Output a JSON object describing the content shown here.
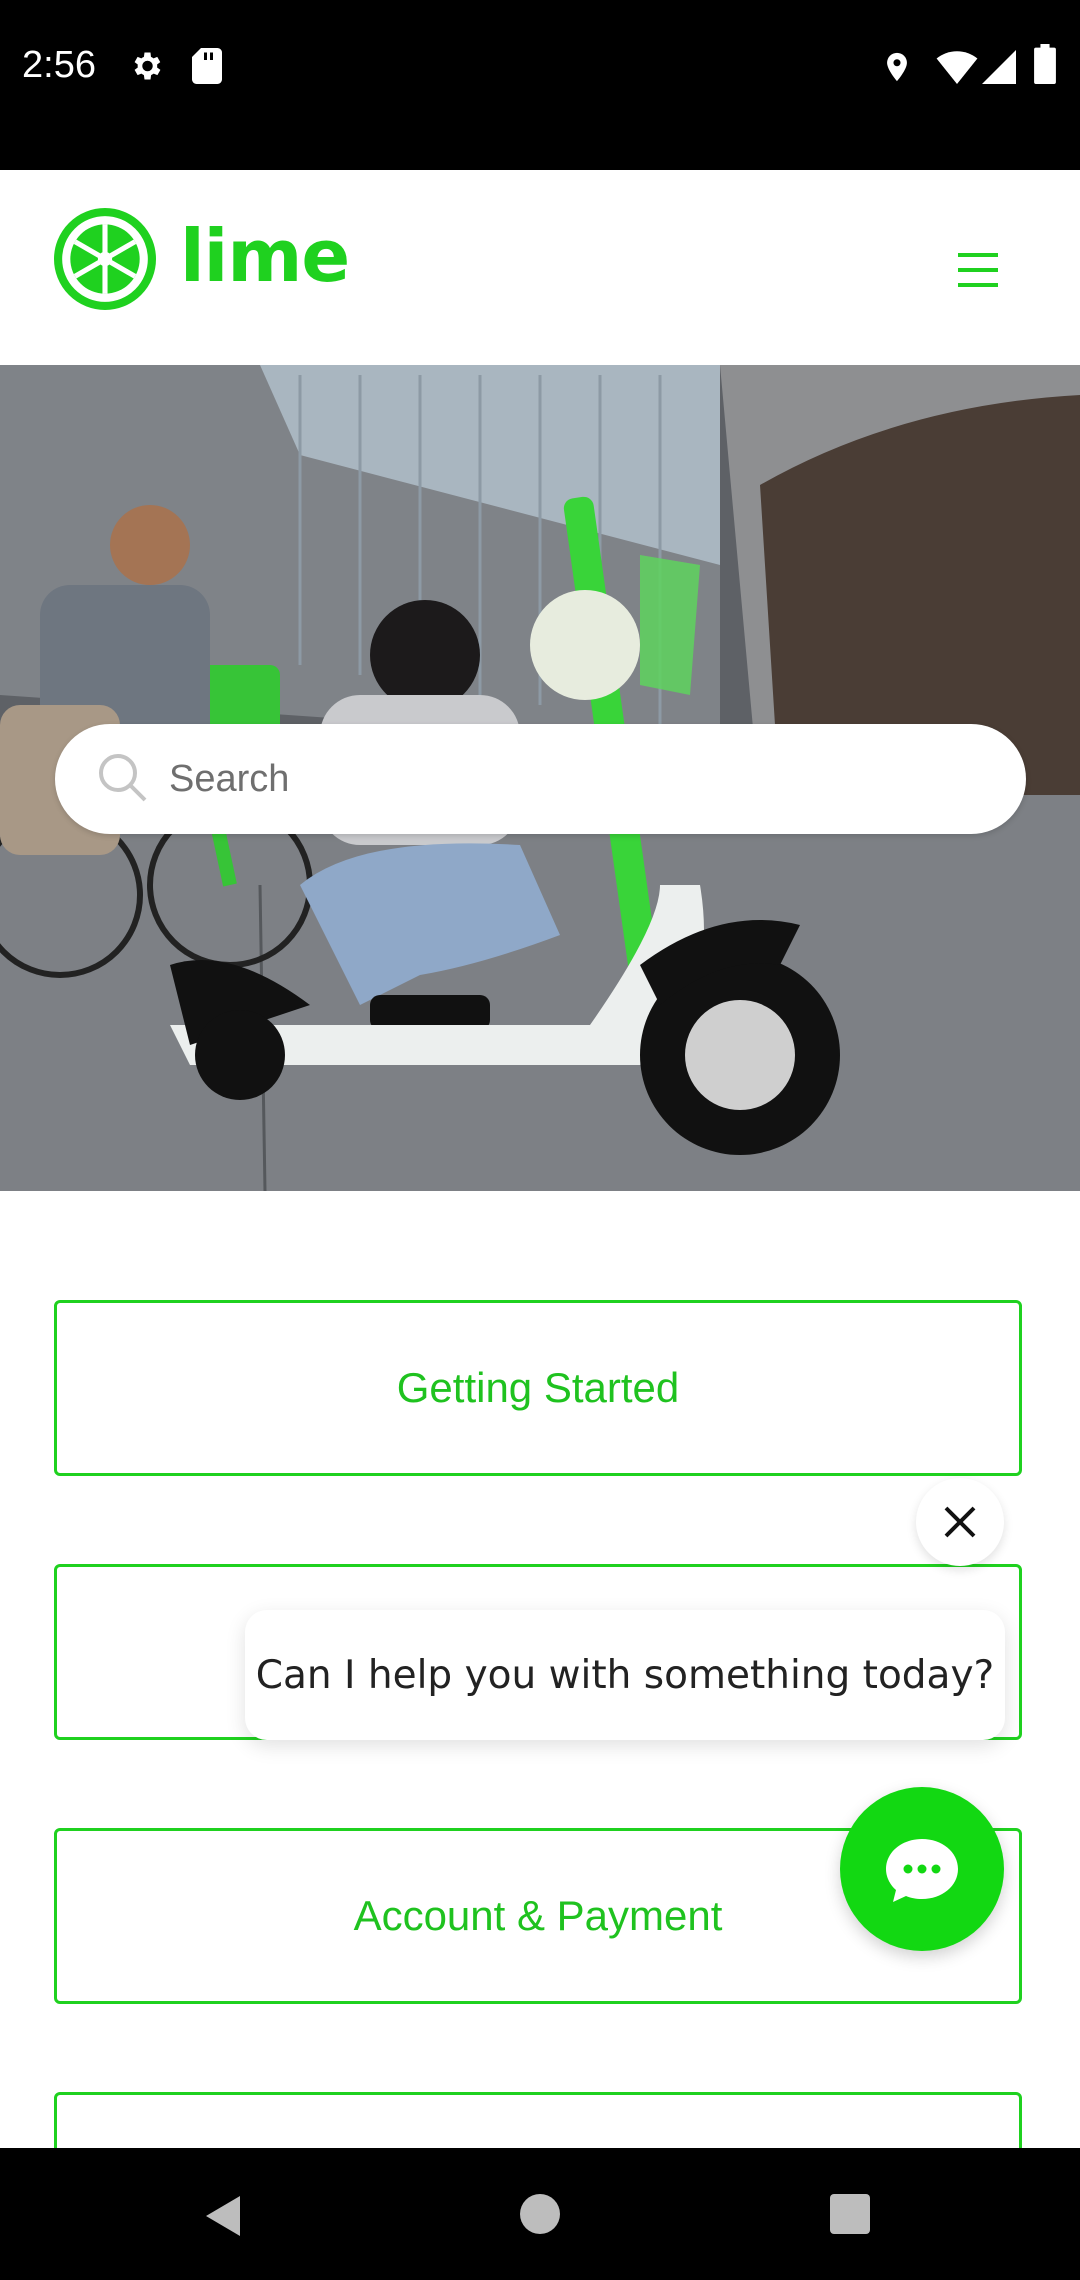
{
  "status_bar": {
    "time": "2:56",
    "icons": [
      "gear-icon",
      "sd-card-icon",
      "location-icon",
      "wifi-icon",
      "signal-icon",
      "battery-icon"
    ]
  },
  "header": {
    "brand": "lime",
    "brand_color": "#1fd11f",
    "menu_icon": "hamburger-icon"
  },
  "search": {
    "placeholder": "Search"
  },
  "categories": [
    {
      "label": "Getting Started"
    },
    {
      "label": ""
    },
    {
      "label": "Account & Payment"
    },
    {
      "label": ""
    }
  ],
  "chat": {
    "prompt": "Can I help you with something today?",
    "fab_color": "#12d812"
  },
  "nav_bar": {
    "icons": [
      "back-icon",
      "home-icon",
      "recents-icon"
    ]
  }
}
